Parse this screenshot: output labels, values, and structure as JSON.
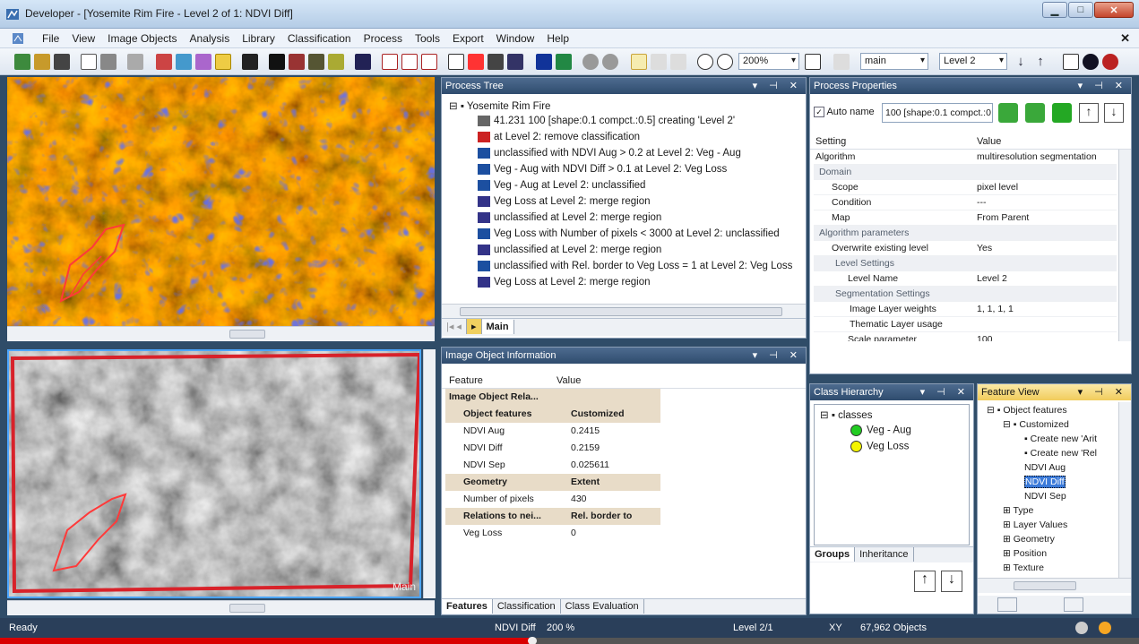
{
  "window": {
    "title": "Developer - [Yosemite Rim Fire - Level 2 of 1: NDVI Diff]"
  },
  "menu": [
    "File",
    "View",
    "Image Objects",
    "Analysis",
    "Library",
    "Classification",
    "Process",
    "Tools",
    "Export",
    "Window",
    "Help"
  ],
  "toolbar": {
    "zoom": "200%",
    "map": "main",
    "level": "Level 2"
  },
  "process_tree": {
    "title": "Process Tree",
    "root": "Yosemite Rim Fire",
    "items": [
      "41.231   100 [shape:0.1 compct.:0.5] creating 'Level 2'",
      "at  Level 2: remove classification",
      "unclassified with NDVI Aug > 0.2  at  Level 2: Veg - Aug",
      "Veg - Aug with NDVI Diff > 0.1  at  Level 2: Veg Loss",
      "Veg - Aug at  Level 2: unclassified",
      "Veg Loss at  Level 2: merge region",
      "unclassified at  Level 2: merge region",
      "Veg Loss with Number of pixels < 3000  at  Level 2: unclassified",
      "unclassified at  Level 2: merge region",
      "unclassified with Rel. border to Veg Loss = 1  at  Level 2: Veg Loss",
      "Veg Loss at  Level 2: merge region"
    ],
    "tab": "Main"
  },
  "process_properties": {
    "title": "Process Properties",
    "auto_name_label": "Auto name",
    "auto_name_value": "100 [shape:0.1 compct.:0",
    "col_setting": "Setting",
    "col_value": "Value",
    "rows": [
      {
        "k": "Algorithm",
        "v": "multiresolution segmentation"
      },
      {
        "k": "Domain",
        "v": ""
      },
      {
        "k": "Scope",
        "v": "pixel level"
      },
      {
        "k": "Condition",
        "v": "---"
      },
      {
        "k": "Map",
        "v": "From Parent"
      },
      {
        "k": "Algorithm parameters",
        "v": ""
      },
      {
        "k": "Overwrite existing level",
        "v": "Yes"
      },
      {
        "k": "Level Settings",
        "v": ""
      },
      {
        "k": "Level Name",
        "v": "Level 2"
      },
      {
        "k": "Segmentation Settings",
        "v": ""
      },
      {
        "k": "Image Layer weights",
        "v": "1, 1, 1, 1"
      },
      {
        "k": "Thematic Layer usage",
        "v": ""
      },
      {
        "k": "Scale parameter",
        "v": "100"
      }
    ]
  },
  "image_object_info": {
    "title": "Image Object Information",
    "col_feature": "Feature",
    "col_value": "Value",
    "rows": [
      {
        "k": "Image Object Rela...",
        "v": "",
        "grp": true
      },
      {
        "k": "Object features",
        "v": "Customized",
        "grp": true
      },
      {
        "k": "NDVI Aug",
        "v": "0.2415"
      },
      {
        "k": "NDVI Diff",
        "v": "0.2159"
      },
      {
        "k": "NDVI Sep",
        "v": "0.025611"
      },
      {
        "k": "Geometry",
        "v": "Extent",
        "grp": true
      },
      {
        "k": "Number of pixels",
        "v": "430"
      },
      {
        "k": "Relations to nei...",
        "v": "Rel. border to",
        "grp": true
      },
      {
        "k": "Veg Loss",
        "v": "0"
      }
    ],
    "tabs": [
      "Features",
      "Classification",
      "Class Evaluation"
    ]
  },
  "class_hierarchy": {
    "title": "Class Hierarchy",
    "root": "classes",
    "classes": [
      {
        "name": "Veg - Aug",
        "color": "#22cc22"
      },
      {
        "name": "Veg Loss",
        "color": "#f4f400"
      }
    ],
    "tabs": [
      "Groups",
      "Inheritance"
    ]
  },
  "feature_view": {
    "title": "Feature View",
    "items": [
      "Object features",
      "Customized",
      "Create new 'Arit",
      "Create new 'Rel",
      "NDVI Aug",
      "NDVI Diff",
      "NDVI Sep",
      "Type",
      "Layer Values",
      "Geometry",
      "Position",
      "Texture"
    ]
  },
  "viewer_bottom": {
    "label": "Main"
  },
  "status": {
    "ready": "Ready",
    "layer": "NDVI Diff",
    "zoom": "200 %",
    "level": "Level 2/1",
    "xy": "XY",
    "objects": "67,962 Objects"
  },
  "video": {
    "progress": 0.467
  }
}
